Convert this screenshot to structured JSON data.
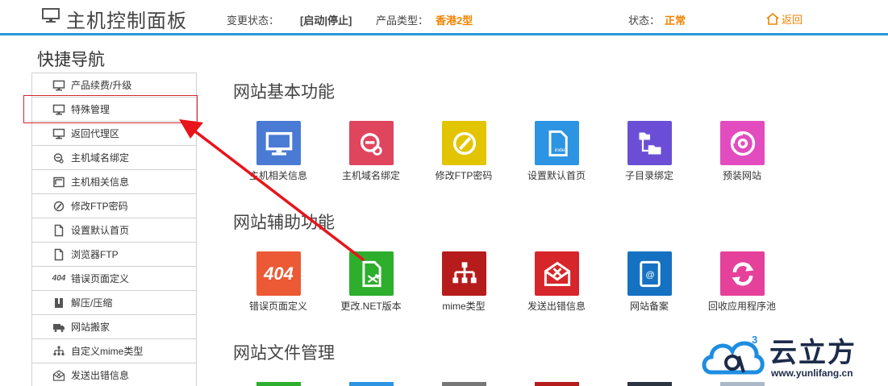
{
  "header": {
    "title": "主机控制面板",
    "change_status_label": "变更状态：",
    "change_status_value": "[启动|停止]",
    "product_type_label": "产品类型：",
    "product_type_value": "香港2型",
    "status_label": "状态：",
    "status_value": "正常",
    "back_label": "返回"
  },
  "sidebar": {
    "title": "快捷导航",
    "items": [
      {
        "label": "产品续费/升级",
        "icon": "monitor-icon"
      },
      {
        "label": "特殊管理",
        "icon": "monitor-icon"
      },
      {
        "label": "返回代理区",
        "icon": "monitor-icon"
      },
      {
        "label": "主机域名绑定",
        "icon": "domain-icon"
      },
      {
        "label": "主机相关信息",
        "icon": "info-icon"
      },
      {
        "label": "修改FTP密码",
        "icon": "pencil-icon"
      },
      {
        "label": "设置默认首页",
        "icon": "file-icon"
      },
      {
        "label": "浏览器FTP",
        "icon": "file-icon"
      },
      {
        "label": "错误页面定义",
        "icon": "404-icon",
        "icon_text": "404"
      },
      {
        "label": "解压/压缩",
        "icon": "archive-icon"
      },
      {
        "label": "网站搬家",
        "icon": "truck-icon"
      },
      {
        "label": "自定义mime类型",
        "icon": "tree-icon"
      },
      {
        "label": "发送出错信息",
        "icon": "mail-icon"
      }
    ]
  },
  "sections": [
    {
      "title": "网站基本功能",
      "tiles": [
        {
          "label": "主机相关信息",
          "color": "#4a7bd4",
          "icon": "monitor-icon"
        },
        {
          "label": "主机域名绑定",
          "color": "#e0455e",
          "icon": "domain-icon"
        },
        {
          "label": "修改FTP密码",
          "color": "#e3c400",
          "icon": "pencil-icon"
        },
        {
          "label": "设置默认首页",
          "color": "#2c94e3",
          "icon": "index-file-icon",
          "icon_text": "index"
        },
        {
          "label": "子目录绑定",
          "color": "#6a4fd6",
          "icon": "folder-tree-icon"
        },
        {
          "label": "预装网站",
          "color": "#e24cbf",
          "icon": "disc-icon"
        }
      ]
    },
    {
      "title": "网站辅助功能",
      "tiles": [
        {
          "label": "错误页面定义",
          "color": "#eb5a35",
          "icon": "404-icon",
          "icon_text": "404"
        },
        {
          "label": "更改.NET版本",
          "color": "#2dae2d",
          "icon": "shuffle-file-icon"
        },
        {
          "label": "mime类型",
          "color": "#b61c1c",
          "icon": "tree-icon"
        },
        {
          "label": "发送出错信息",
          "color": "#d7262b",
          "icon": "mail-icon"
        },
        {
          "label": "网站备案",
          "color": "#1571c2",
          "icon": "address-book-icon"
        },
        {
          "label": "回收应用程序池",
          "color": "#e5419b",
          "icon": "recycle-icon"
        }
      ]
    },
    {
      "title": "网站文件管理",
      "partial_colors": [
        "#2dae2d",
        "#2c94e3",
        "#777777",
        "#b61c1c",
        "#2b3440",
        "#aab8c8"
      ]
    }
  ],
  "watermark": {
    "brand": "云立方",
    "url": "www.yunlifang.cn",
    "superscript": "3"
  }
}
